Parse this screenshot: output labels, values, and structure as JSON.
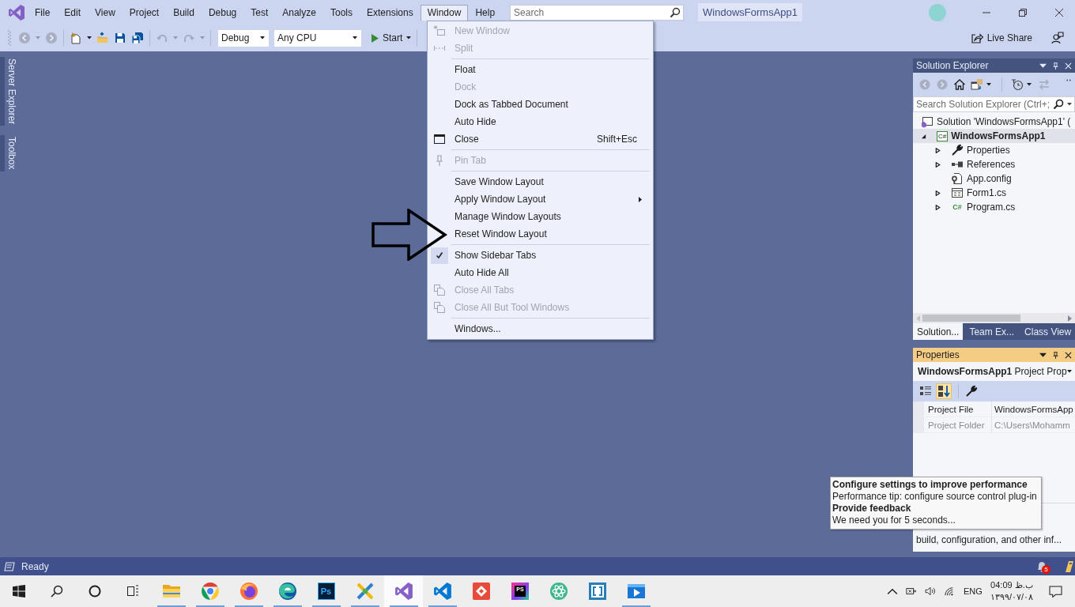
{
  "menu_bar": [
    {
      "label": "File",
      "selected": false
    },
    {
      "label": "Edit",
      "selected": false
    },
    {
      "label": "View",
      "selected": false
    },
    {
      "label": "Project",
      "selected": false
    },
    {
      "label": "Build",
      "selected": false
    },
    {
      "label": "Debug",
      "selected": false
    },
    {
      "label": "Test",
      "selected": false
    },
    {
      "label": "Analyze",
      "selected": false
    },
    {
      "label": "Tools",
      "selected": false
    },
    {
      "label": "Extensions",
      "selected": false
    },
    {
      "label": "Window",
      "selected": true
    },
    {
      "label": "Help",
      "selected": false
    }
  ],
  "search": {
    "placeholder": "Search"
  },
  "solution_title": "WindowsFormsApp1",
  "toolbar": {
    "configuration": "Debug",
    "platform": "Any CPU",
    "start": "Start",
    "live_share": "Live Share"
  },
  "side_tabs": [
    "Server Explorer",
    "Toolbox"
  ],
  "window_menu": {
    "groups": [
      [
        {
          "label": "New Window",
          "disabled": true,
          "checked": false,
          "submenu": false
        },
        {
          "label": "Split",
          "disabled": true,
          "checked": false,
          "submenu": false
        }
      ],
      [
        {
          "label": "Float",
          "disabled": false,
          "checked": false,
          "submenu": false
        },
        {
          "label": "Dock",
          "disabled": true,
          "checked": false,
          "submenu": false
        },
        {
          "label": "Dock as Tabbed Document",
          "disabled": false,
          "checked": false,
          "submenu": false
        },
        {
          "label": "Auto Hide",
          "disabled": false,
          "checked": false,
          "submenu": false
        },
        {
          "label": "Close",
          "shortcut": "Shift+Esc",
          "disabled": false,
          "checked": false,
          "submenu": false
        }
      ],
      [
        {
          "label": "Pin Tab",
          "disabled": true,
          "checked": false,
          "submenu": false
        }
      ],
      [
        {
          "label": "Save Window Layout",
          "disabled": false,
          "checked": false,
          "submenu": false
        },
        {
          "label": "Apply Window Layout",
          "disabled": false,
          "checked": false,
          "submenu": true
        },
        {
          "label": "Manage Window Layouts",
          "disabled": false,
          "checked": false,
          "submenu": false
        },
        {
          "label": "Reset Window Layout",
          "disabled": false,
          "checked": false,
          "submenu": false
        }
      ],
      [
        {
          "label": "Show Sidebar Tabs",
          "disabled": false,
          "checked": true,
          "submenu": false
        },
        {
          "label": "Auto Hide All",
          "disabled": false,
          "checked": false,
          "submenu": false
        },
        {
          "label": "Close All Tabs",
          "disabled": true,
          "checked": false,
          "submenu": false
        },
        {
          "label": "Close All But Tool Windows",
          "disabled": true,
          "checked": false,
          "submenu": false
        }
      ],
      [
        {
          "label": "Windows...",
          "disabled": false,
          "checked": false,
          "submenu": false
        }
      ]
    ]
  },
  "solution_explorer": {
    "title": "Solution Explorer",
    "active": false,
    "search": {
      "placeholder": "Search Solution Explorer (Ctrl+;"
    },
    "tree": [
      {
        "label": "Solution 'WindowsFormsApp1' (",
        "kind": "solution",
        "selected": false,
        "children": [
          {
            "label": "WindowsFormsApp1",
            "kind": "project",
            "badge": "C#",
            "selected": true,
            "expanded": true,
            "children": [
              {
                "label": "Properties",
                "kind": "properties",
                "selected": false,
                "expanded": false
              },
              {
                "label": "References",
                "kind": "references",
                "selected": false,
                "expanded": false
              },
              {
                "label": "App.config",
                "kind": "config",
                "selected": false
              },
              {
                "label": "Form1.cs",
                "kind": "form",
                "selected": false,
                "expanded": false
              },
              {
                "label": "Program.cs",
                "kind": "code",
                "badge": "C#",
                "selected": false,
                "expanded": false
              }
            ]
          }
        ]
      }
    ],
    "tabs": [
      {
        "label": "Solution...",
        "selected": true
      },
      {
        "label": "Team Ex...",
        "selected": false
      },
      {
        "label": "Class View",
        "selected": false
      }
    ]
  },
  "properties": {
    "title": "Properties",
    "active": true,
    "object_name": "WindowsFormsApp1",
    "object_type": "Project Prop",
    "view_buttons": [
      {
        "selected": false
      },
      {
        "selected": true
      }
    ],
    "grid": [
      {
        "name": "Project File",
        "value": "WindowsFormsApp",
        "disabled": false
      },
      {
        "name": "Project Folder",
        "value": "C:\\Users\\Mohamm",
        "disabled": true
      }
    ],
    "description": "build, configuration, and other inf..."
  },
  "tooltip": {
    "lines": [
      {
        "text": "Configure settings to improve performance",
        "kind": "heading"
      },
      {
        "text": "Performance tip: configure source control plug-in",
        "kind": "text"
      },
      {
        "text": "Provide feedback",
        "kind": "heading"
      },
      {
        "text": "We need you for 5 seconds...",
        "kind": "text"
      }
    ]
  },
  "status_bar": {
    "text": "Ready",
    "notifications": "5"
  },
  "taskbar": {
    "apps": [
      {
        "running": true,
        "selected": false
      },
      {
        "running": true,
        "selected": false
      },
      {
        "running": true,
        "selected": false
      },
      {
        "running": true,
        "selected": false
      },
      {
        "text": "Ps",
        "running": true,
        "selected": false
      },
      {
        "running": true,
        "selected": false
      },
      {
        "running": true,
        "selected": true
      },
      {
        "running": true,
        "selected": false
      },
      {
        "running": false,
        "selected": false
      },
      {
        "text": "PS",
        "running": false,
        "selected": false
      },
      {
        "running": false,
        "selected": false
      },
      {
        "running": false,
        "selected": false
      },
      {
        "running": true,
        "selected": false
      }
    ],
    "language": "ENG",
    "time": "04:09 ب.ظ",
    "date": "۱۳۹۹/۰۷/۰۸"
  }
}
